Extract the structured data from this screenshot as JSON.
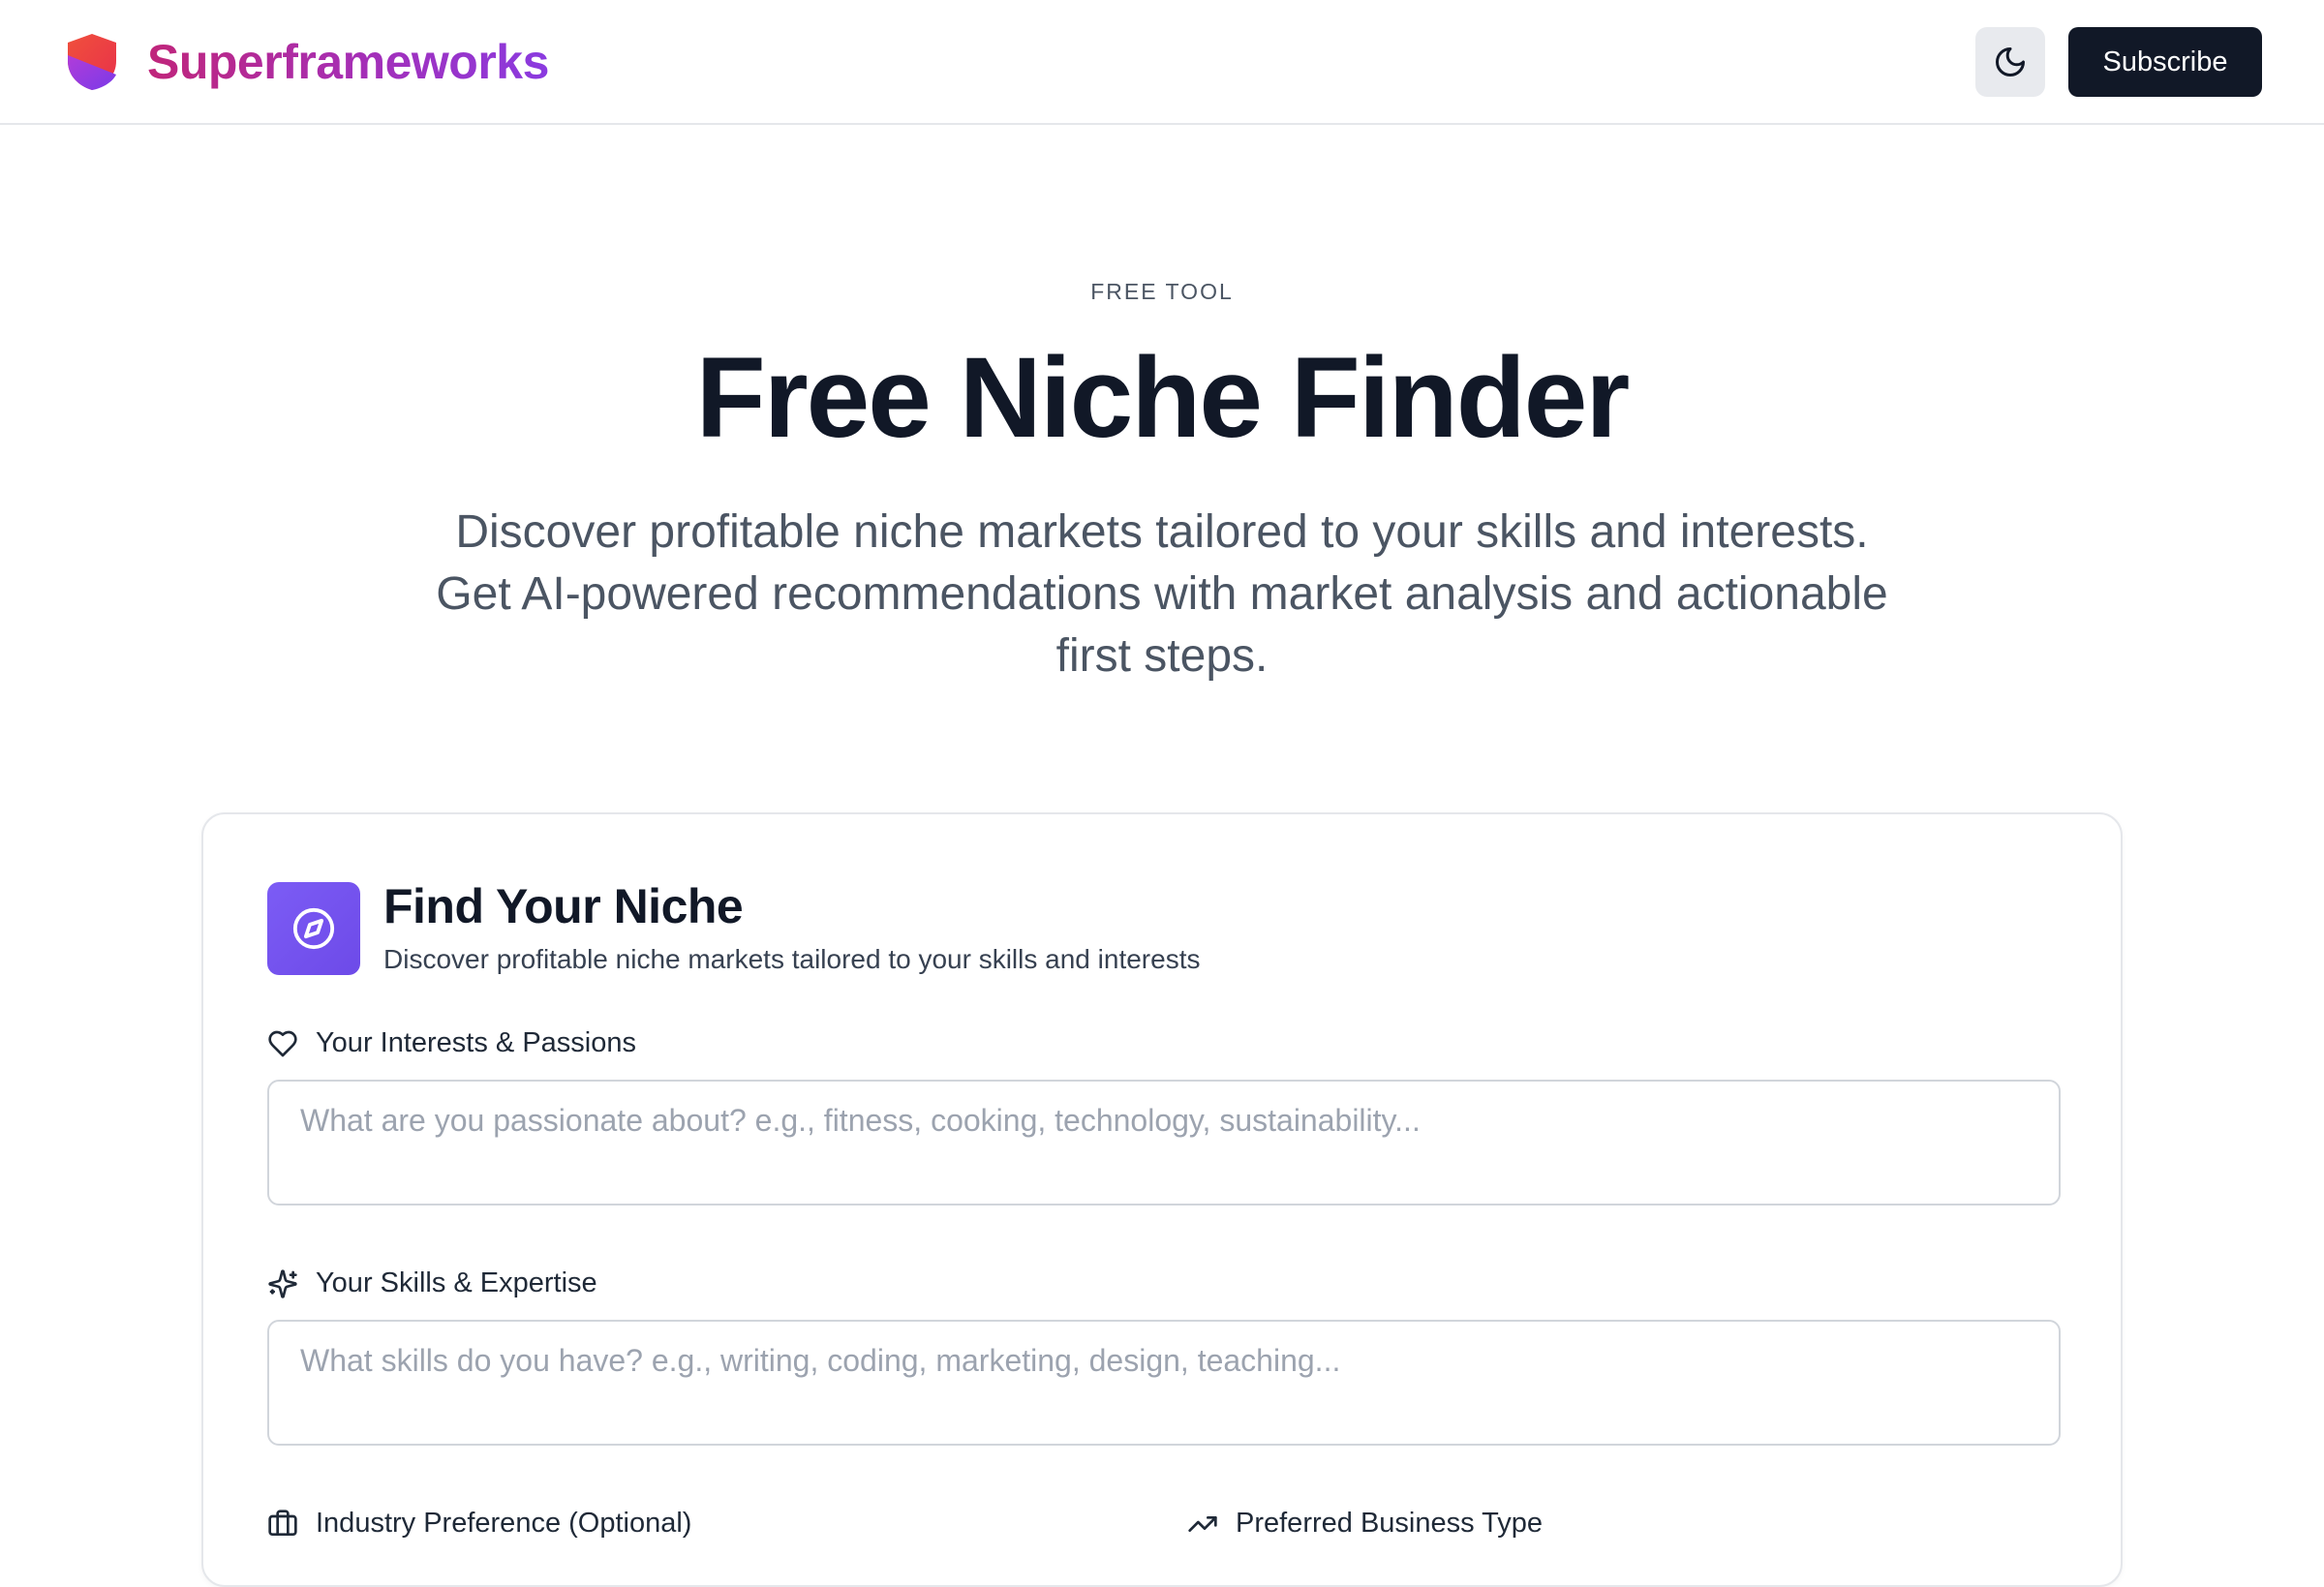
{
  "header": {
    "brand_name": "Superframeworks",
    "subscribe_label": "Subscribe"
  },
  "icons": {
    "logo": "shield-logo",
    "theme_toggle": "moon-icon",
    "card": "compass-icon",
    "interests": "heart-icon",
    "skills": "sparkles-icon",
    "industry": "briefcase-icon",
    "business_type": "trending-up-icon"
  },
  "colors": {
    "brand_gradient_start": "#c0257a",
    "brand_gradient_end": "#8a3ae0",
    "accent_purple": "#7c5cf5",
    "dark_button": "#111827"
  },
  "hero": {
    "eyebrow": "FREE TOOL",
    "title": "Free Niche Finder",
    "subtitle": "Discover profitable niche markets tailored to your skills and interests. Get AI-powered recommendations with market analysis and actionable first steps."
  },
  "card": {
    "title": "Find Your Niche",
    "subtitle": "Discover profitable niche markets tailored to your skills and interests",
    "fields": {
      "interests": {
        "label": "Your Interests & Passions",
        "placeholder": "What are you passionate about? e.g., fitness, cooking, technology, sustainability...",
        "value": ""
      },
      "skills": {
        "label": "Your Skills & Expertise",
        "placeholder": "What skills do you have? e.g., writing, coding, marketing, design, teaching...",
        "value": ""
      },
      "industry": {
        "label": "Industry Preference (Optional)"
      },
      "business_type": {
        "label": "Preferred Business Type"
      }
    }
  }
}
